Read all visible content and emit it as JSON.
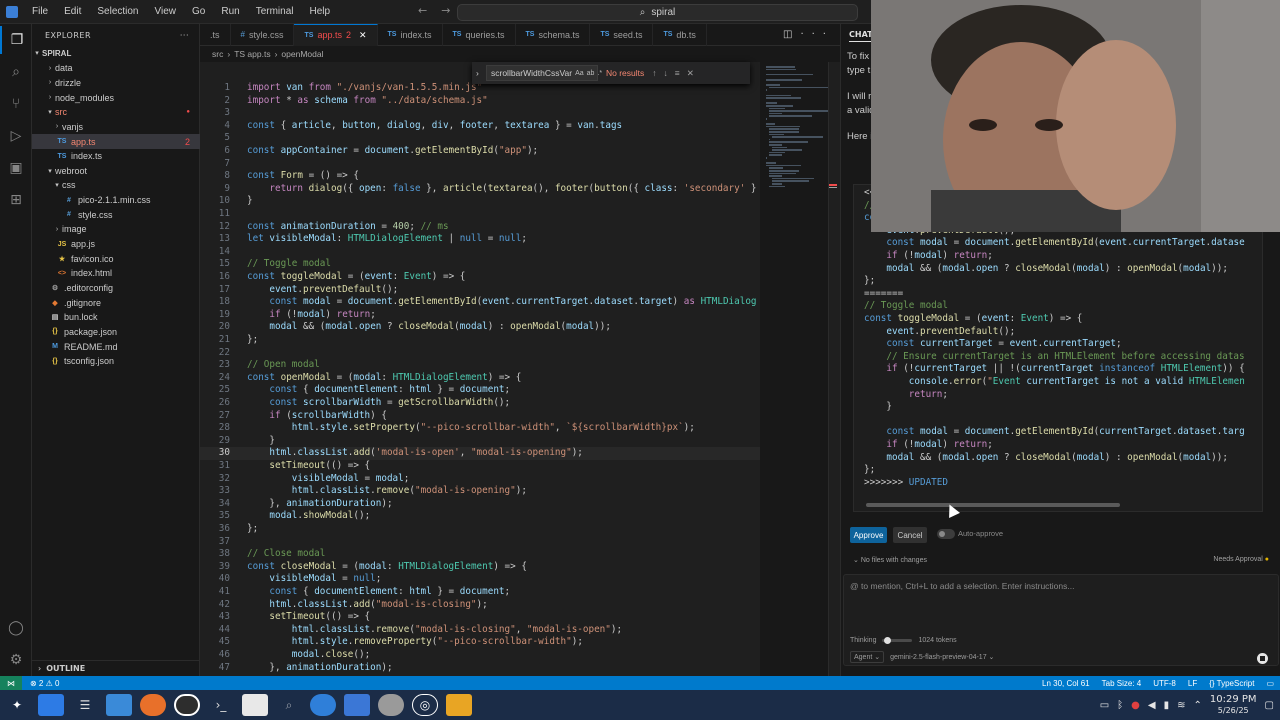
{
  "menu": [
    "File",
    "Edit",
    "Selection",
    "View",
    "Go",
    "Run",
    "Terminal",
    "Help"
  ],
  "search": {
    "label": "spiral"
  },
  "tabs": [
    {
      "label": ".ts",
      "kind": "partial",
      "active": false,
      "errors": ""
    },
    {
      "label": "style.css",
      "kind": "css",
      "active": false,
      "errors": ""
    },
    {
      "label": "app.ts",
      "kind": "ts",
      "active": true,
      "errors": "2"
    },
    {
      "label": "index.ts",
      "kind": "ts",
      "active": false,
      "errors": ""
    },
    {
      "label": "queries.ts",
      "kind": "ts",
      "active": false,
      "errors": ""
    },
    {
      "label": "schema.ts",
      "kind": "ts",
      "active": false,
      "errors": ""
    },
    {
      "label": "seed.ts",
      "kind": "ts",
      "active": false,
      "errors": ""
    },
    {
      "label": "db.ts",
      "kind": "ts",
      "active": false,
      "errors": ""
    }
  ],
  "breadcrumb": [
    "src",
    "TS app.ts",
    "openModal"
  ],
  "find": {
    "query": "scrollbarWidthCssVar",
    "result": "No results",
    "options": [
      "Aa",
      "ab",
      ".*"
    ]
  },
  "explorer": {
    "title": "EXPLORER",
    "root": "SPIRAL",
    "items": [
      {
        "label": "data",
        "depth": 1,
        "type": "folder",
        "open": false
      },
      {
        "label": "drizzle",
        "depth": 1,
        "type": "folder",
        "open": false
      },
      {
        "label": "node_modules",
        "depth": 1,
        "type": "folder",
        "open": false
      },
      {
        "label": "src",
        "depth": 1,
        "type": "folder",
        "open": true,
        "color": "#f48771"
      },
      {
        "label": "vanjs",
        "depth": 2,
        "type": "folder",
        "open": false
      },
      {
        "label": "app.ts",
        "depth": 2,
        "type": "ts",
        "selected": true,
        "badge": "2",
        "color": "#f48771"
      },
      {
        "label": "index.ts",
        "depth": 2,
        "type": "ts"
      },
      {
        "label": "webroot",
        "depth": 1,
        "type": "folder",
        "open": true
      },
      {
        "label": "css",
        "depth": 2,
        "type": "folder",
        "open": true
      },
      {
        "label": "pico-2.1.1.min.css",
        "depth": 3,
        "type": "css"
      },
      {
        "label": "style.css",
        "depth": 3,
        "type": "css"
      },
      {
        "label": "image",
        "depth": 2,
        "type": "folder",
        "open": false
      },
      {
        "label": "app.js",
        "depth": 2,
        "type": "js"
      },
      {
        "label": "favicon.ico",
        "depth": 2,
        "type": "ico"
      },
      {
        "label": "index.html",
        "depth": 2,
        "type": "html"
      },
      {
        "label": ".editorconfig",
        "depth": 1,
        "type": "cfg"
      },
      {
        "label": ".gitignore",
        "depth": 1,
        "type": "git"
      },
      {
        "label": "bun.lock",
        "depth": 1,
        "type": "lock"
      },
      {
        "label": "package.json",
        "depth": 1,
        "type": "json"
      },
      {
        "label": "README.md",
        "depth": 1,
        "type": "md"
      },
      {
        "label": "tsconfig.json",
        "depth": 1,
        "type": "json"
      }
    ],
    "outline": "OUTLINE"
  },
  "code": {
    "start_line": 1,
    "current_line": 30,
    "lines": [
      "import van from \"./vanjs/van-1.5.5.min.js\"",
      "import * as schema from \"../data/schema.js\"",
      "",
      "const { article, button, dialog, div, footer, textarea } = van.tags",
      "",
      "const appContainer = document.getElementById(\"app\");",
      "",
      "const Form = () => {",
      "    return dialog({ open: false }, article(textarea(), footer(button({ class: 'secondary' }",
      "}",
      "",
      "const animationDuration = 400; // ms",
      "let visibleModal: HTMLDialogElement | null = null;",
      "",
      "// Toggle modal",
      "const toggleModal = (event: Event) => {",
      "    event.preventDefault();",
      "    const modal = document.getElementById(event.currentTarget.dataset.target) as HTMLDialog",
      "    if (!modal) return;",
      "    modal && (modal.open ? closeModal(modal) : openModal(modal));",
      "};",
      "",
      "// Open modal",
      "const openModal = (modal: HTMLDialogElement) => {",
      "    const { documentElement: html } = document;",
      "    const scrollbarWidth = getScrollbarWidth();",
      "    if (scrollbarWidth) {",
      "        html.style.setProperty(\"--pico-scrollbar-width\", `${scrollbarWidth}px`);",
      "    }",
      "    html.classList.add('modal-is-open', \"modal-is-opening\");",
      "    setTimeout(() => {",
      "        visibleModal = modal;",
      "        html.classList.remove(\"modal-is-opening\");",
      "    }, animationDuration);",
      "    modal.showModal();",
      "};",
      "",
      "// Close modal",
      "const closeModal = (modal: HTMLDialogElement) => {",
      "    visibleModal = null;",
      "    const { documentElement: html } = document;",
      "    html.classList.add(\"modal-is-closing\");",
      "    setTimeout(() => {",
      "        html.classList.remove(\"modal-is-closing\", \"modal-is-open\");",
      "        html.style.removeProperty(\"--pico-scrollbar-width\");",
      "        modal.close();",
      "    }, animationDuration);"
    ]
  },
  "chat": {
    "header": "CHAT",
    "text_fragments": [
      "To fix",
      "type t",
      "I will r",
      "a valid",
      "Here i"
    ],
    "diff_lines": [
      "<<",
      "// ",
      "const toggleModal = (event: Event) => {",
      "    event.preventDefault();",
      "    const modal = document.getElementById(event.currentTarget.datase",
      "    if (!modal) return;",
      "    modal && (modal.open ? closeModal(modal) : openModal(modal));",
      "};",
      "=======",
      "// Toggle modal",
      "const toggleModal = (event: Event) => {",
      "    event.preventDefault();",
      "    const currentTarget = event.currentTarget;",
      "    // Ensure currentTarget is an HTMLElement before accessing datas",
      "    if (!currentTarget || !(currentTarget instanceof HTMLElement)) {",
      "        console.error(\"Event currentTarget is not a valid HTMLElemen",
      "        return;",
      "    }",
      "",
      "    const modal = document.getElementById(currentTarget.dataset.targ",
      "    if (!modal) return;",
      "    modal && (modal.open ? closeModal(modal) : openModal(modal));",
      "};",
      ">>>>>>> UPDATED"
    ],
    "approve_label": "Approve",
    "cancel_label": "Cancel",
    "auto_approve_label": "Auto-approve",
    "no_files_label": "No files with changes",
    "needs_approval_label": "Needs Approval",
    "input_placeholder": "@ to mention, Ctrl+L to add a selection. Enter instructions...",
    "thinking_label": "Thinking",
    "tokens_label": "1024 tokens",
    "agent_label": "Agent",
    "model_label": "gemini-2.5-flash-preview-04-17"
  },
  "status": {
    "problems": "⊗ 2 ⚠ 0",
    "position": "Ln 30, Col 61",
    "tab_size": "Tab Size: 4",
    "encoding": "UTF-8",
    "eol": "LF",
    "language": "{} TypeScript"
  },
  "taskbar": {
    "time": "10:29 PM",
    "date": "5/26/25"
  },
  "colors": {
    "keyword": "#569cd6",
    "control": "#c586c0",
    "string": "#ce9178",
    "comment": "#6a9955",
    "function": "#dcdcaa",
    "type": "#4ec9b0",
    "variable": "#9cdcfe",
    "number": "#b5cea8",
    "accent": "#0078d4"
  }
}
